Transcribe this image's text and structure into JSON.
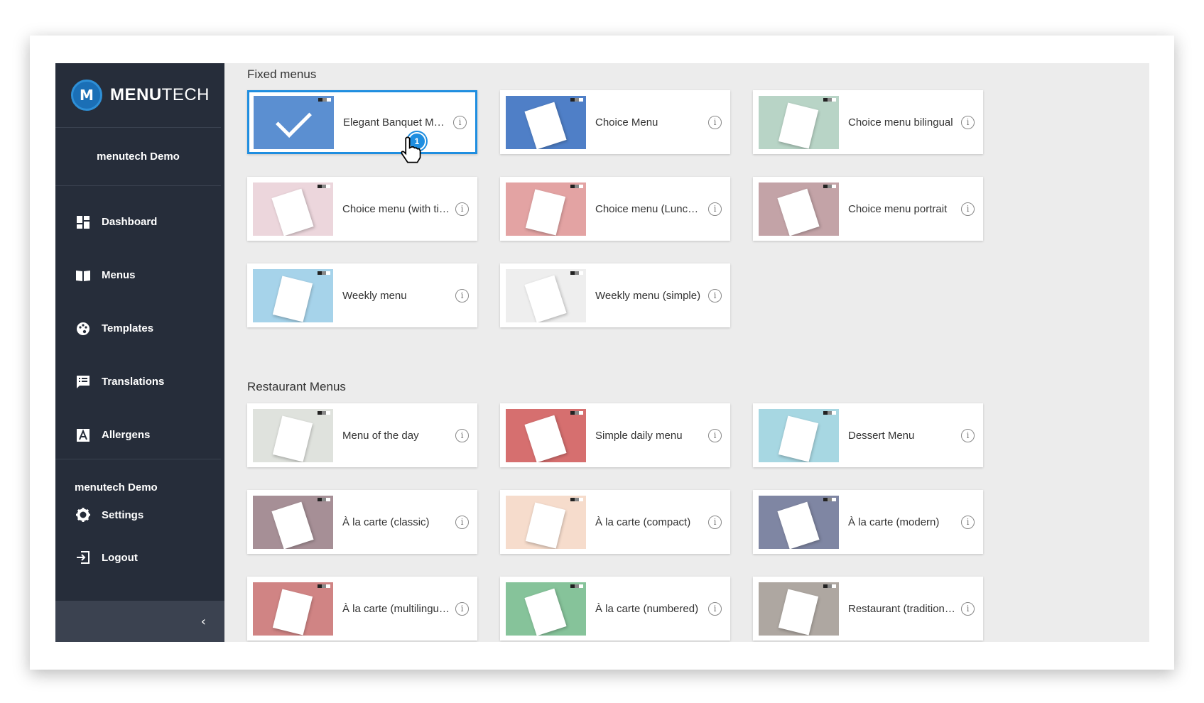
{
  "brand": {
    "name_bold": "MENU",
    "name_light": "TECH",
    "logo_letter": "M"
  },
  "account": {
    "name": "menutech Demo"
  },
  "nav": [
    {
      "label": "Dashboard",
      "icon": "dashboard-icon"
    },
    {
      "label": "Menus",
      "icon": "book-icon"
    },
    {
      "label": "Templates",
      "icon": "palette-icon"
    },
    {
      "label": "Translations",
      "icon": "chat-icon"
    },
    {
      "label": "Allergens",
      "icon": "allergen-icon"
    }
  ],
  "footer": {
    "title": "menutech Demo",
    "settings": "Settings",
    "logout": "Logout",
    "collapse": "‹"
  },
  "sections": {
    "fixed": {
      "title": "Fixed menus",
      "cards": [
        {
          "title": "Elegant Banquet Me...",
          "color": "#5b8fd1",
          "selected": true
        },
        {
          "title": "Choice Menu",
          "color": "#4f7fc7"
        },
        {
          "title": "Choice menu bilingual",
          "color": "#b8d4c6"
        },
        {
          "title": "Choice menu (with titl...",
          "color": "#ecd6dc"
        },
        {
          "title": "Choice menu (Lunch-...",
          "color": "#e3a3a3"
        },
        {
          "title": "Choice menu portrait",
          "color": "#c3a3a7"
        },
        {
          "title": "Weekly menu",
          "color": "#a6d3ea"
        },
        {
          "title": "Weekly menu (simple)",
          "color": "#eeeeee"
        }
      ]
    },
    "restaurant": {
      "title": "Restaurant Menus",
      "cards": [
        {
          "title": "Menu of the day",
          "color": "#dfe2dd"
        },
        {
          "title": "Simple daily menu",
          "color": "#d66f6f"
        },
        {
          "title": "Dessert Menu",
          "color": "#a7d7e2"
        },
        {
          "title": "À la carte (classic)",
          "color": "#a68f96"
        },
        {
          "title": "À la carte (compact)",
          "color": "#f6dccc"
        },
        {
          "title": "À la carte (modern)",
          "color": "#7f86a3"
        },
        {
          "title": "À la carte (multilingual)",
          "color": "#d08484"
        },
        {
          "title": "À la carte (numbered)",
          "color": "#86c39a"
        },
        {
          "title": "Restaurant (traditional)",
          "color": "#aea7a1"
        }
      ]
    }
  },
  "cursor": {
    "badge": "1"
  },
  "info_glyph": "i"
}
